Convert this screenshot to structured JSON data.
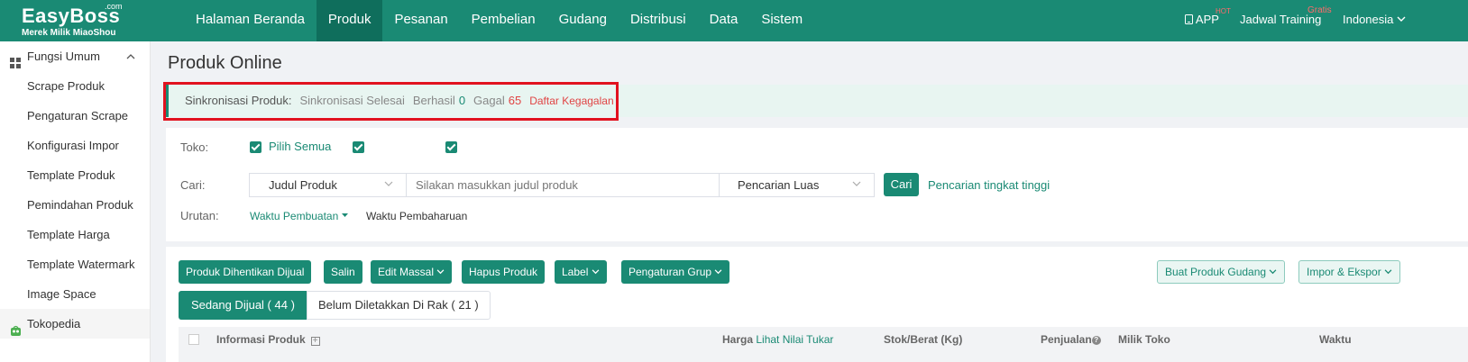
{
  "header": {
    "logo_com": ".com",
    "logo_name": "EasyBoss",
    "logo_sub": "Merek Milik MiaoShou",
    "nav": [
      {
        "label": "Halaman Beranda"
      },
      {
        "label": "Produk"
      },
      {
        "label": "Pesanan"
      },
      {
        "label": "Pembelian"
      },
      {
        "label": "Gudang"
      },
      {
        "label": "Distribusi"
      },
      {
        "label": "Data"
      },
      {
        "label": "Sistem"
      }
    ],
    "active_nav": "Produk",
    "app_label": "APP",
    "app_badge": "HOT",
    "training_label": "Jadwal Training",
    "training_badge": "Gratis",
    "language": "Indonesia"
  },
  "sidebar": {
    "group1": "Fungsi Umum",
    "items": [
      {
        "label": "Scrape Produk"
      },
      {
        "label": "Pengaturan Scrape"
      },
      {
        "label": "Konfigurasi Impor"
      },
      {
        "label": "Template Produk"
      },
      {
        "label": "Pemindahan Produk"
      },
      {
        "label": "Template Harga"
      },
      {
        "label": "Template Watermark"
      },
      {
        "label": "Image Space"
      }
    ],
    "group2": "Tokopedia"
  },
  "main": {
    "title": "Produk Online",
    "sync": {
      "label": "Sinkronisasi Produk:",
      "status": "Sinkronisasi Selesai",
      "ok_label": "Berhasil",
      "ok_count": "0",
      "fail_label": "Gagal",
      "fail_count": "65",
      "fail_link": "Daftar Kegagalan"
    },
    "filter": {
      "toko_label": "Toko:",
      "select_all": "Pilih Semua",
      "store1": "",
      "store2": "",
      "cari_label": "Cari:",
      "search_field": "Judul Produk",
      "search_placeholder": "Silakan masukkan judul produk",
      "search_mode": "Pencarian Luas",
      "search_button": "Cari",
      "advanced_link": "Pencarian tingkat tinggi",
      "sort_label": "Urutan:",
      "sort_active": "Waktu Pembuatan",
      "sort_other": "Waktu Pembaharuan"
    },
    "toolbar": {
      "stop_selling": "Produk Dihentikan Dijual",
      "copy": "Salin",
      "bulk_edit": "Edit Massal",
      "delete": "Hapus Produk",
      "label": "Label",
      "group_settings": "Pengaturan Grup",
      "create_warehouse": "Buat Produk Gudang",
      "import_export": "Impor & Ekspor"
    },
    "tabs": {
      "active": "Sedang Dijual ( 44 )",
      "other": "Belum Diletakkan Di Rak ( 21 )"
    },
    "table_headers": {
      "info": "Informasi Produk",
      "price": "Harga",
      "price_link": "Lihat Nilai Tukar",
      "stock": "Stok/Berat (Kg)",
      "sales": "Penjualan",
      "shop": "Milik Toko",
      "time": "Waktu"
    }
  }
}
